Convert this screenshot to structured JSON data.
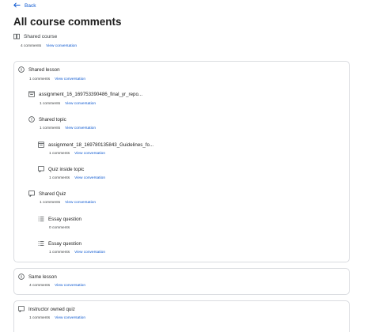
{
  "back_label": "Back",
  "page_title": "All course comments",
  "course": {
    "label": "Shared course",
    "comments": "4 comments",
    "link": "View conversation"
  },
  "card_main": {
    "items": [
      {
        "label": "Shared lesson",
        "comments": "1 comments",
        "link": "View conversation"
      },
      {
        "label": "assignment_16_169753390486_final_yr_repo...",
        "comments": "1 comments",
        "link": "View conversation"
      },
      {
        "label": "Shared topic",
        "comments": "1 comments",
        "link": "View conversation"
      },
      {
        "label": "assignment_18_169780135843_Guidelines_fo...",
        "comments": "1 comments",
        "link": "View conversation"
      },
      {
        "label": "Quiz inside topic",
        "comments": "1 comments",
        "link": "View conversation"
      },
      {
        "label": "Shared Quiz",
        "comments": "1 comments",
        "link": "View conversation"
      },
      {
        "label": "Essay question",
        "comments": "0 comments",
        "link": ""
      },
      {
        "label": "Essay question",
        "comments": "1 comments",
        "link": "View conversation"
      }
    ]
  },
  "card_lesson": {
    "label": "Same lesson",
    "comments": "4 comments",
    "link": "View conversation"
  },
  "card_quiz": {
    "label": "Instructor owned quiz",
    "comments": "1 comments",
    "link": "View conversation"
  },
  "icons": {
    "back": "arrow-left-icon",
    "course": "book-icon",
    "lesson": "lesson-icon",
    "assignment": "assignment-icon",
    "topic": "topic-icon",
    "quiz": "quiz-icon",
    "question": "question-list-icon"
  },
  "colors": {
    "link": "#0b57d0",
    "border": "#dadce0"
  }
}
